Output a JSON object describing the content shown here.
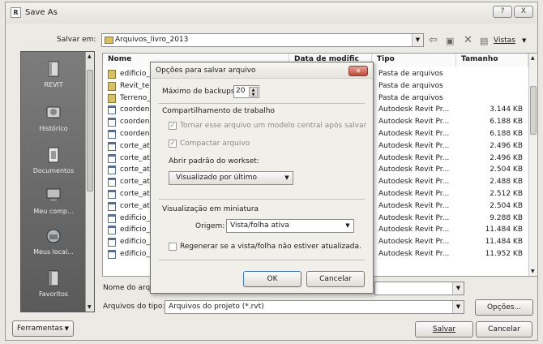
{
  "window": {
    "title": "Save As",
    "app_icon": "R",
    "help_label": "?",
    "close_label": "X"
  },
  "save_in": {
    "label": "Salvar em:",
    "value": "Arquivos_livro_2013"
  },
  "toolbar": {
    "views_label": "Vistas"
  },
  "places": [
    {
      "label": "REVIT",
      "icon": "revit-folder-icon"
    },
    {
      "label": "Histórico",
      "icon": "history-icon"
    },
    {
      "label": "Documentos",
      "icon": "documents-icon"
    },
    {
      "label": "Meu comp...",
      "icon": "computer-icon"
    },
    {
      "label": "Meus locai...",
      "icon": "network-places-icon"
    },
    {
      "label": "Favoritos",
      "icon": "favorites-icon"
    }
  ],
  "file_list": {
    "columns": [
      "Nome",
      "Data de modific",
      "Tipo",
      "Tamanho"
    ],
    "rows": [
      {
        "name": "edificio_",
        "type": "Pasta de arquivos",
        "size": "",
        "kind": "folder"
      },
      {
        "name": "Revit_te",
        "type": "Pasta de arquivos",
        "size": "",
        "kind": "folder"
      },
      {
        "name": "Terreno_",
        "type": "Pasta de arquivos",
        "size": "",
        "kind": "folder"
      },
      {
        "name": "coorden",
        "type": "Autodesk Revit Pr...",
        "size": "3.144 KB",
        "kind": "file"
      },
      {
        "name": "coorden",
        "type": "Autodesk Revit Pr...",
        "size": "6.188 KB",
        "kind": "file"
      },
      {
        "name": "coorden",
        "type": "Autodesk Revit Pr...",
        "size": "6.188 KB",
        "kind": "file"
      },
      {
        "name": "corte_at",
        "type": "Autodesk Revit Pr...",
        "size": "2.496 KB",
        "kind": "file"
      },
      {
        "name": "corte_at",
        "type": "Autodesk Revit Pr...",
        "size": "2.496 KB",
        "kind": "file"
      },
      {
        "name": "corte_at",
        "type": "Autodesk Revit Pr...",
        "size": "2.504 KB",
        "kind": "file"
      },
      {
        "name": "corte_at",
        "type": "Autodesk Revit Pr...",
        "size": "2.488 KB",
        "kind": "file"
      },
      {
        "name": "corte_at",
        "type": "Autodesk Revit Pr...",
        "size": "2.512 KB",
        "kind": "file"
      },
      {
        "name": "corte_at",
        "type": "Autodesk Revit Pr...",
        "size": "2.504 KB",
        "kind": "file"
      },
      {
        "name": "edificio_",
        "type": "Autodesk Revit Pr...",
        "size": "9.288 KB",
        "kind": "file"
      },
      {
        "name": "edificio_",
        "type": "Autodesk Revit Pr...",
        "size": "11.484 KB",
        "kind": "file"
      },
      {
        "name": "edificio_",
        "type": "Autodesk Revit Pr...",
        "size": "11.484 KB",
        "kind": "file"
      },
      {
        "name": "edificio_",
        "type": "Autodesk Revit Pr...",
        "size": "11.952 KB",
        "kind": "file"
      }
    ]
  },
  "file_name": {
    "label": "Nome do arqu",
    "value": ""
  },
  "file_type": {
    "label": "Arquivos do tipo:",
    "value": "Arquivos do projeto  (*.rvt)"
  },
  "buttons": {
    "options": "Opções...",
    "save": "Salvar",
    "cancel": "Cancelar",
    "tools": "Ferramentas"
  },
  "dialog": {
    "title": "Opções para salvar arquivo",
    "max_backups_label": "Máximo de backups:",
    "max_backups_value": "20",
    "worksharing_header": "Compartilhamento de trabalho",
    "make_central_label": "Tornar esse arquivo um modelo central após salvar",
    "compact_label": "Compactar arquivo",
    "open_workset_label": "Abrir padrão do workset:",
    "open_workset_value": "Visualizado por último",
    "thumbnail_header": "Visualização em miniatura",
    "source_label": "Origem:",
    "source_value": "Vista/folha ativa",
    "regenerate_label": "Regenerar se a vista/folha não estiver atualizada.",
    "ok": "OK",
    "cancel": "Cancelar"
  }
}
